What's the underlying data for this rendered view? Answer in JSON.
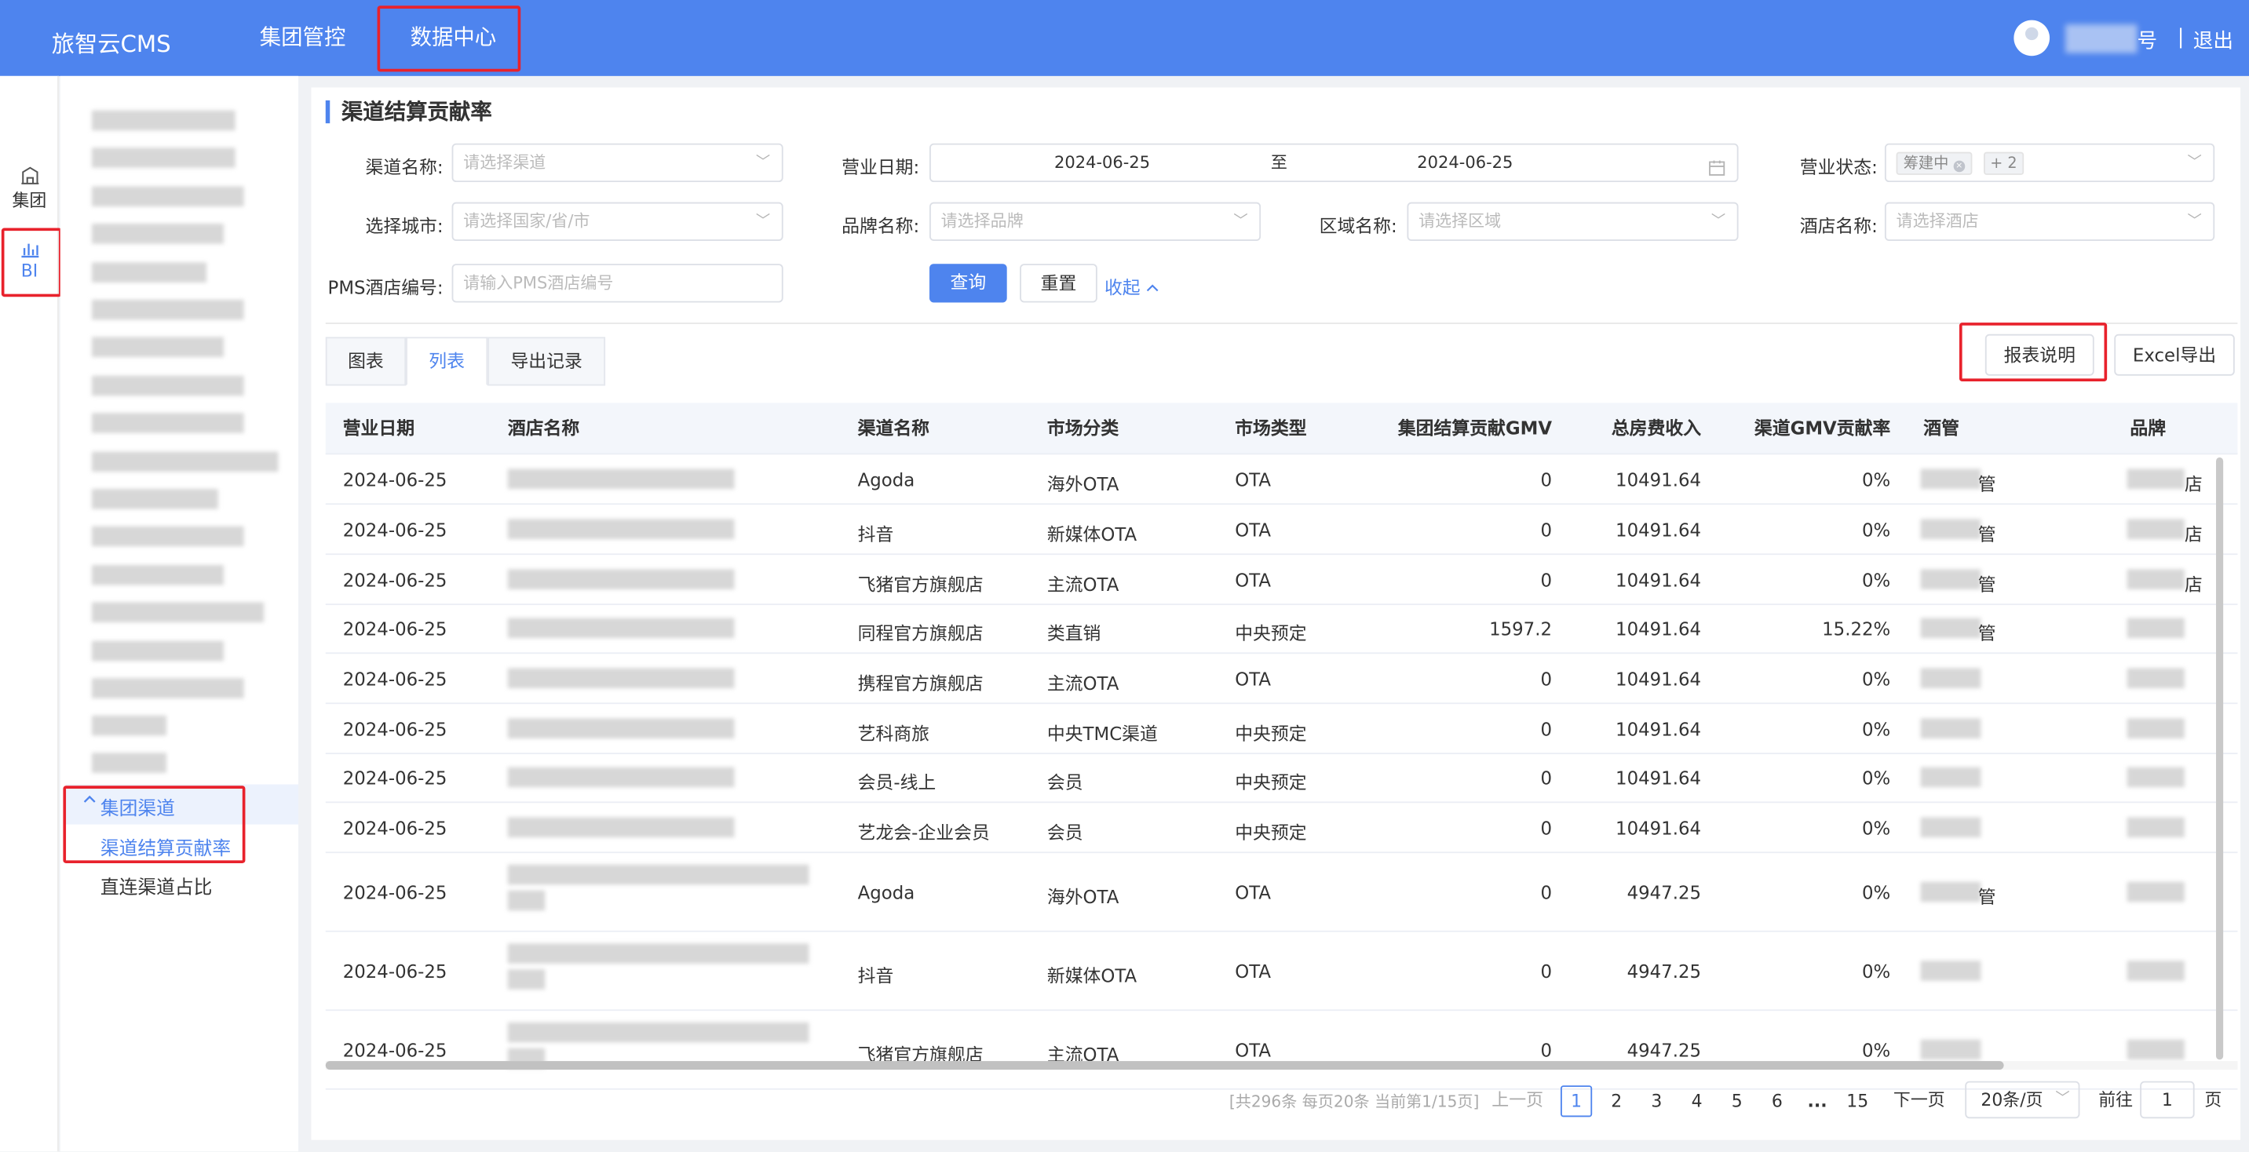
{
  "app": {
    "brand": "旅智云CMS"
  },
  "topnav": [
    {
      "label": "集团管控"
    },
    {
      "label": "数据中心"
    }
  ],
  "user": {
    "account_suffix": "号",
    "separator": "|",
    "logout": "退出"
  },
  "rail": [
    {
      "label": "集团",
      "icon": "building-icon"
    },
    {
      "label": "BI",
      "icon": "bar-chart-icon"
    }
  ],
  "sidebar": {
    "group": {
      "label": "集团渠道",
      "icon": "chevron-up-icon"
    },
    "items": [
      {
        "label": "渠道结算贡献率",
        "active": true
      },
      {
        "label": "直连渠道占比",
        "active": false
      }
    ]
  },
  "page": {
    "title": "渠道结算贡献率"
  },
  "filters": {
    "channel": {
      "label": "渠道名称:",
      "placeholder": "请选择渠道"
    },
    "date": {
      "label": "营业日期:",
      "start": "2024-06-25",
      "to": "至",
      "end": "2024-06-25"
    },
    "status": {
      "label": "营业状态:",
      "tag1": "筹建中",
      "tag2": "+ 2"
    },
    "city": {
      "label": "选择城市:",
      "placeholder": "请选择国家/省/市"
    },
    "brand": {
      "label": "品牌名称:",
      "placeholder": "请选择品牌"
    },
    "region": {
      "label": "区域名称:",
      "placeholder": "请选择区域"
    },
    "hotel": {
      "label": "酒店名称:",
      "placeholder": "请选择酒店"
    },
    "pms": {
      "label": "PMS酒店编号:",
      "placeholder": "请输入PMS酒店编号"
    },
    "query_label": "查询",
    "reset_label": "重置",
    "collapse_label": "收起",
    "collapse_icon": "chevron-up-icon"
  },
  "tabs": [
    {
      "label": "图表"
    },
    {
      "label": "列表",
      "active": true
    },
    {
      "label": "导出记录"
    }
  ],
  "actions": {
    "report_desc": "报表说明",
    "excel_export": "Excel导出"
  },
  "table": {
    "columns": [
      "营业日期",
      "酒店名称",
      "渠道名称",
      "市场分类",
      "市场类型",
      "集团结算贡献GMV",
      "总房费收入",
      "渠道GMV贡献率",
      "酒管",
      "品牌"
    ],
    "rows": [
      {
        "date": "2024-06-25",
        "channel": "Agoda",
        "market_cat": "海外OTA",
        "market_type": "OTA",
        "gmv": "0",
        "revenue": "10491.64",
        "rate": "0%",
        "mgmt_tail": "管",
        "brand_tail": "店"
      },
      {
        "date": "2024-06-25",
        "channel": "抖音",
        "market_cat": "新媒体OTA",
        "market_type": "OTA",
        "gmv": "0",
        "revenue": "10491.64",
        "rate": "0%",
        "mgmt_tail": "管",
        "brand_tail": "店"
      },
      {
        "date": "2024-06-25",
        "channel": "飞猪官方旗舰店",
        "market_cat": "主流OTA",
        "market_type": "OTA",
        "gmv": "0",
        "revenue": "10491.64",
        "rate": "0%",
        "mgmt_tail": "管",
        "brand_tail": "店"
      },
      {
        "date": "2024-06-25",
        "channel": "同程官方旗舰店",
        "market_cat": "类直销",
        "market_type": "中央预定",
        "gmv": "1597.2",
        "revenue": "10491.64",
        "rate": "15.22%",
        "mgmt_tail": "管",
        "brand_tail": ""
      },
      {
        "date": "2024-06-25",
        "channel": "携程官方旗舰店",
        "market_cat": "主流OTA",
        "market_type": "OTA",
        "gmv": "0",
        "revenue": "10491.64",
        "rate": "0%",
        "mgmt_tail": "",
        "brand_tail": ""
      },
      {
        "date": "2024-06-25",
        "channel": "艺科商旅",
        "market_cat": "中央TMC渠道",
        "market_type": "中央预定",
        "gmv": "0",
        "revenue": "10491.64",
        "rate": "0%",
        "mgmt_tail": "",
        "brand_tail": ""
      },
      {
        "date": "2024-06-25",
        "channel": "会员-线上",
        "market_cat": "会员",
        "market_type": "中央预定",
        "gmv": "0",
        "revenue": "10491.64",
        "rate": "0%",
        "mgmt_tail": "",
        "brand_tail": ""
      },
      {
        "date": "2024-06-25",
        "channel": "艺龙会-企业会员",
        "market_cat": "会员",
        "market_type": "中央预定",
        "gmv": "0",
        "revenue": "10491.64",
        "rate": "0%",
        "mgmt_tail": "",
        "brand_tail": ""
      },
      {
        "date": "2024-06-25",
        "channel": "Agoda",
        "market_cat": "海外OTA",
        "market_type": "OTA",
        "gmv": "0",
        "revenue": "4947.25",
        "rate": "0%",
        "mgmt_tail": "管",
        "brand_tail": ""
      },
      {
        "date": "2024-06-25",
        "channel": "抖音",
        "market_cat": "新媒体OTA",
        "market_type": "OTA",
        "gmv": "0",
        "revenue": "4947.25",
        "rate": "0%",
        "mgmt_tail": "",
        "brand_tail": ""
      },
      {
        "date": "2024-06-25",
        "channel": "飞猪官方旗舰店",
        "market_cat": "主流OTA",
        "market_type": "OTA",
        "gmv": "0",
        "revenue": "4947.25",
        "rate": "0%",
        "mgmt_tail": "",
        "brand_tail": ""
      }
    ]
  },
  "pagination": {
    "summary": "[共296条 每页20条 当前第1/15页]",
    "prev": "上一页",
    "pages": [
      "1",
      "2",
      "3",
      "4",
      "5",
      "6"
    ],
    "ellipsis": "...",
    "last": "15",
    "next": "下一页",
    "page_size": "20条/页",
    "goto_label": "前往",
    "goto_value": "1",
    "goto_suffix": "页",
    "current": 1
  },
  "colors": {
    "primary": "#4e84ee",
    "highlight_box": "#e8222c"
  }
}
